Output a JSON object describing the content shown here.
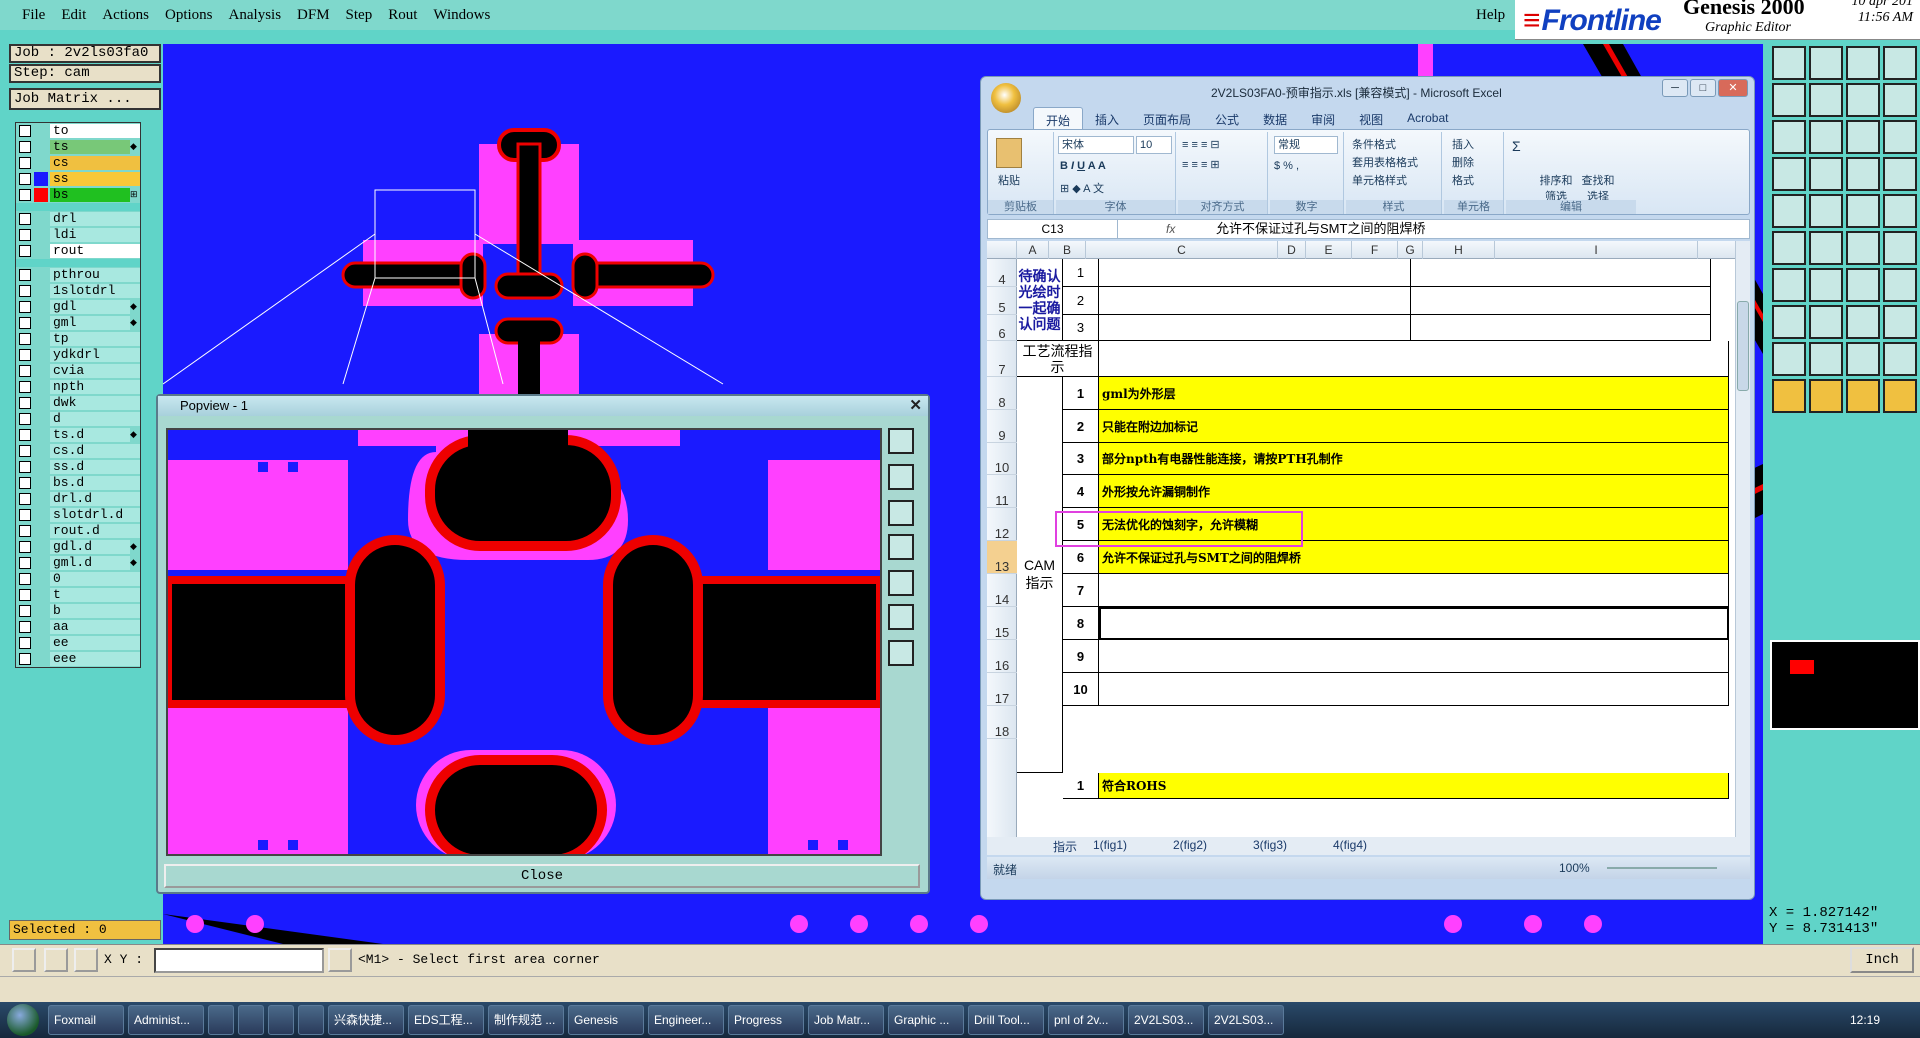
{
  "menu": {
    "items": [
      "File",
      "Edit",
      "Actions",
      "Options",
      "Analysis",
      "DFM",
      "Step",
      "Rout",
      "Windows"
    ],
    "help": "Help"
  },
  "brand": {
    "logo": "Frontline",
    "product": "Genesis 2000",
    "subtitle": "Graphic Editor",
    "date": "10 apr 201",
    "time": "11:56 AM"
  },
  "job": {
    "job_label": "Job : 2v2ls03fa0",
    "step_label": "Step: cam",
    "matrix_button": "Job Matrix ..."
  },
  "layers": [
    {
      "name": "to",
      "style": "w"
    },
    {
      "name": "ts",
      "style": "g",
      "mark": "◆"
    },
    {
      "name": "cs",
      "style": "y"
    },
    {
      "name": "ss",
      "style": "y2",
      "swatch": "#1a1aff"
    },
    {
      "name": "bs",
      "style": "sel",
      "swatch": "#ff0000",
      "mark": "⊞"
    },
    {
      "sep": true
    },
    {
      "name": "drl",
      "style": ""
    },
    {
      "name": "ldi",
      "style": ""
    },
    {
      "name": "rout",
      "style": "w"
    },
    {
      "sep": true
    },
    {
      "name": "pthrou",
      "style": ""
    },
    {
      "name": "1slotdrl",
      "style": ""
    },
    {
      "name": "gdl",
      "style": "",
      "mark": "◆"
    },
    {
      "name": "gml",
      "style": "",
      "mark": "◆"
    },
    {
      "name": "tp",
      "style": ""
    },
    {
      "name": "ydkdrl",
      "style": ""
    },
    {
      "name": "cvia",
      "style": ""
    },
    {
      "name": "npth",
      "style": ""
    },
    {
      "name": "dwk",
      "style": ""
    },
    {
      "name": "d",
      "style": ""
    },
    {
      "name": "ts.d",
      "style": "",
      "mark": "◆"
    },
    {
      "name": "cs.d",
      "style": ""
    },
    {
      "name": "ss.d",
      "style": ""
    },
    {
      "name": "bs.d",
      "style": ""
    },
    {
      "name": "drl.d",
      "style": ""
    },
    {
      "name": "slotdrl.d",
      "style": ""
    },
    {
      "name": "rout.d",
      "style": ""
    },
    {
      "name": "gdl.d",
      "style": "",
      "mark": "◆"
    },
    {
      "name": "gml.d",
      "style": "",
      "mark": "◆"
    },
    {
      "name": "0",
      "style": ""
    },
    {
      "name": "t",
      "style": ""
    },
    {
      "name": "b",
      "style": ""
    },
    {
      "name": "aa",
      "style": ""
    },
    {
      "name": "ee",
      "style": ""
    },
    {
      "name": "eee",
      "style": ""
    }
  ],
  "selected_label": "Selected : 0",
  "coords": {
    "x": "X = 1.827142\"",
    "y": "Y = 8.731413\""
  },
  "status": {
    "xy_label": "X Y :",
    "input_value": "",
    "message": "<M1> - Select first area corner",
    "units": "Inch"
  },
  "popview": {
    "title": "Popview - 1",
    "close_label": "Close",
    "close_x": "✕"
  },
  "excel": {
    "title": "2V2LS03FA0-预审指示.xls  [兼容模式] - Microsoft Excel",
    "tabs": [
      "开始",
      "插入",
      "页面布局",
      "公式",
      "数据",
      "审阅",
      "视图",
      "Acrobat"
    ],
    "font_name": "宋体",
    "font_size": "10",
    "number_format": "常规",
    "groups": [
      "剪贴板",
      "字体",
      "对齐方式",
      "数字",
      "样式",
      "单元格",
      "编辑"
    ],
    "paste_label": "粘贴",
    "style_items": [
      "条件格式",
      "套用表格格式",
      "单元格样式"
    ],
    "cell_items": [
      "插入",
      "删除",
      "格式"
    ],
    "edit_items": [
      "排序和筛选",
      "查找和选择"
    ],
    "name_box": "C13",
    "fx": "fx",
    "formula": "允许不保证过孔与SMT之间的阻焊桥",
    "columns": [
      "A",
      "B",
      "C",
      "D",
      "E",
      "F",
      "G",
      "H",
      "I"
    ],
    "rows": [
      "4",
      "5",
      "6",
      "7",
      "8",
      "9",
      "10",
      "11",
      "12",
      "13",
      "14",
      "15",
      "16",
      "17",
      "18"
    ],
    "block1_label": "待确认光绘时一起确认问题",
    "block1_nums": [
      "1",
      "2",
      "3"
    ],
    "flow_label": "工艺流程指示",
    "cam_label": "CAM指示",
    "cam_nums": [
      "1",
      "2",
      "3",
      "4",
      "5",
      "6",
      "7",
      "8",
      "9",
      "10"
    ],
    "cam_items": [
      "gml为外形层",
      "只能在附边加标记",
      "部分npth有电器性能连接，请按PTH孔制作",
      "外形按允许漏铜制作",
      "无法优化的蚀刻字，允许模糊",
      "允许不保证过孔与SMT之间的阻焊桥"
    ],
    "last_num": "1",
    "last_item": "符合ROHS",
    "sheet_tabs": [
      "指示",
      "1(fig1)",
      "2(fig2)",
      "3(fig3)",
      "4(fig4)"
    ],
    "ready": "就绪",
    "zoom": "100%"
  },
  "taskbar": {
    "items": [
      "Foxmail",
      "Administ...",
      "",
      "",
      "",
      "",
      "兴森快捷...",
      "EDS工程...",
      "制作规范 ...",
      "Genesis",
      "Engineer...",
      "Progress",
      "Job Matr...",
      "Graphic ...",
      "Drill Tool...",
      "pnl of 2v...",
      "2V2LS03...",
      "2V2LS03..."
    ],
    "clock": "12:19"
  }
}
